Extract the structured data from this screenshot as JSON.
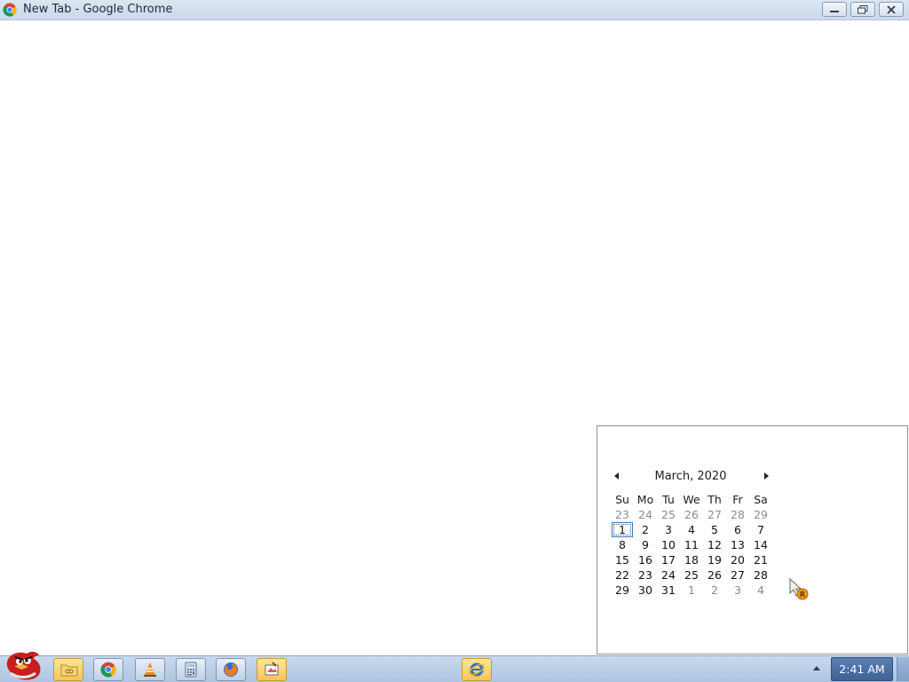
{
  "window": {
    "title": "New Tab - Google Chrome",
    "icon": "chrome-icon",
    "controls": [
      "minimize-icon",
      "restore-icon",
      "close-icon"
    ]
  },
  "calendar": {
    "month_label": "March, 2020",
    "prev_icon": "triangle-left-icon",
    "next_icon": "triangle-right-icon",
    "weekdays": [
      "Su",
      "Mo",
      "Tu",
      "We",
      "Th",
      "Fr",
      "Sa"
    ],
    "today": "1",
    "weeks": [
      [
        "23",
        "24",
        "25",
        "26",
        "27",
        "28",
        "29"
      ],
      [
        "1",
        "2",
        "3",
        "4",
        "5",
        "6",
        "7"
      ],
      [
        "8",
        "9",
        "10",
        "11",
        "12",
        "13",
        "14"
      ],
      [
        "15",
        "16",
        "17",
        "18",
        "19",
        "20",
        "21"
      ],
      [
        "22",
        "23",
        "24",
        "25",
        "26",
        "27",
        "28"
      ],
      [
        "29",
        "30",
        "31",
        "1",
        "2",
        "3",
        "4"
      ]
    ],
    "other_month_mask": [
      [
        true,
        true,
        true,
        true,
        true,
        true,
        true
      ],
      [
        false,
        false,
        false,
        false,
        false,
        false,
        false
      ],
      [
        false,
        false,
        false,
        false,
        false,
        false,
        false
      ],
      [
        false,
        false,
        false,
        false,
        false,
        false,
        false
      ],
      [
        false,
        false,
        false,
        false,
        false,
        false,
        false
      ],
      [
        false,
        false,
        false,
        true,
        true,
        true,
        true
      ]
    ]
  },
  "taskbar": {
    "start_icon": "angry-bird-start-icon",
    "pinned": [
      {
        "name": "folder-icon",
        "active": true
      },
      {
        "name": "chrome-icon",
        "active": false
      },
      {
        "name": "vlc-icon",
        "active": false
      },
      {
        "name": "calculator-icon",
        "active": false
      },
      {
        "name": "firefox-icon",
        "active": false
      },
      {
        "name": "paint-icon",
        "active": true
      },
      {
        "name": "internet-explorer-icon",
        "active": true
      }
    ],
    "clock": "2:41 AM",
    "tray_arrow_icon": "triangle-up-icon"
  },
  "colors": {
    "titlebar": "#c9d9ec",
    "taskbar": "#aec5e2",
    "clock_bg": "#3d6298",
    "today_border": "#3b78c6",
    "other_month_text": "#8b8b8b"
  }
}
